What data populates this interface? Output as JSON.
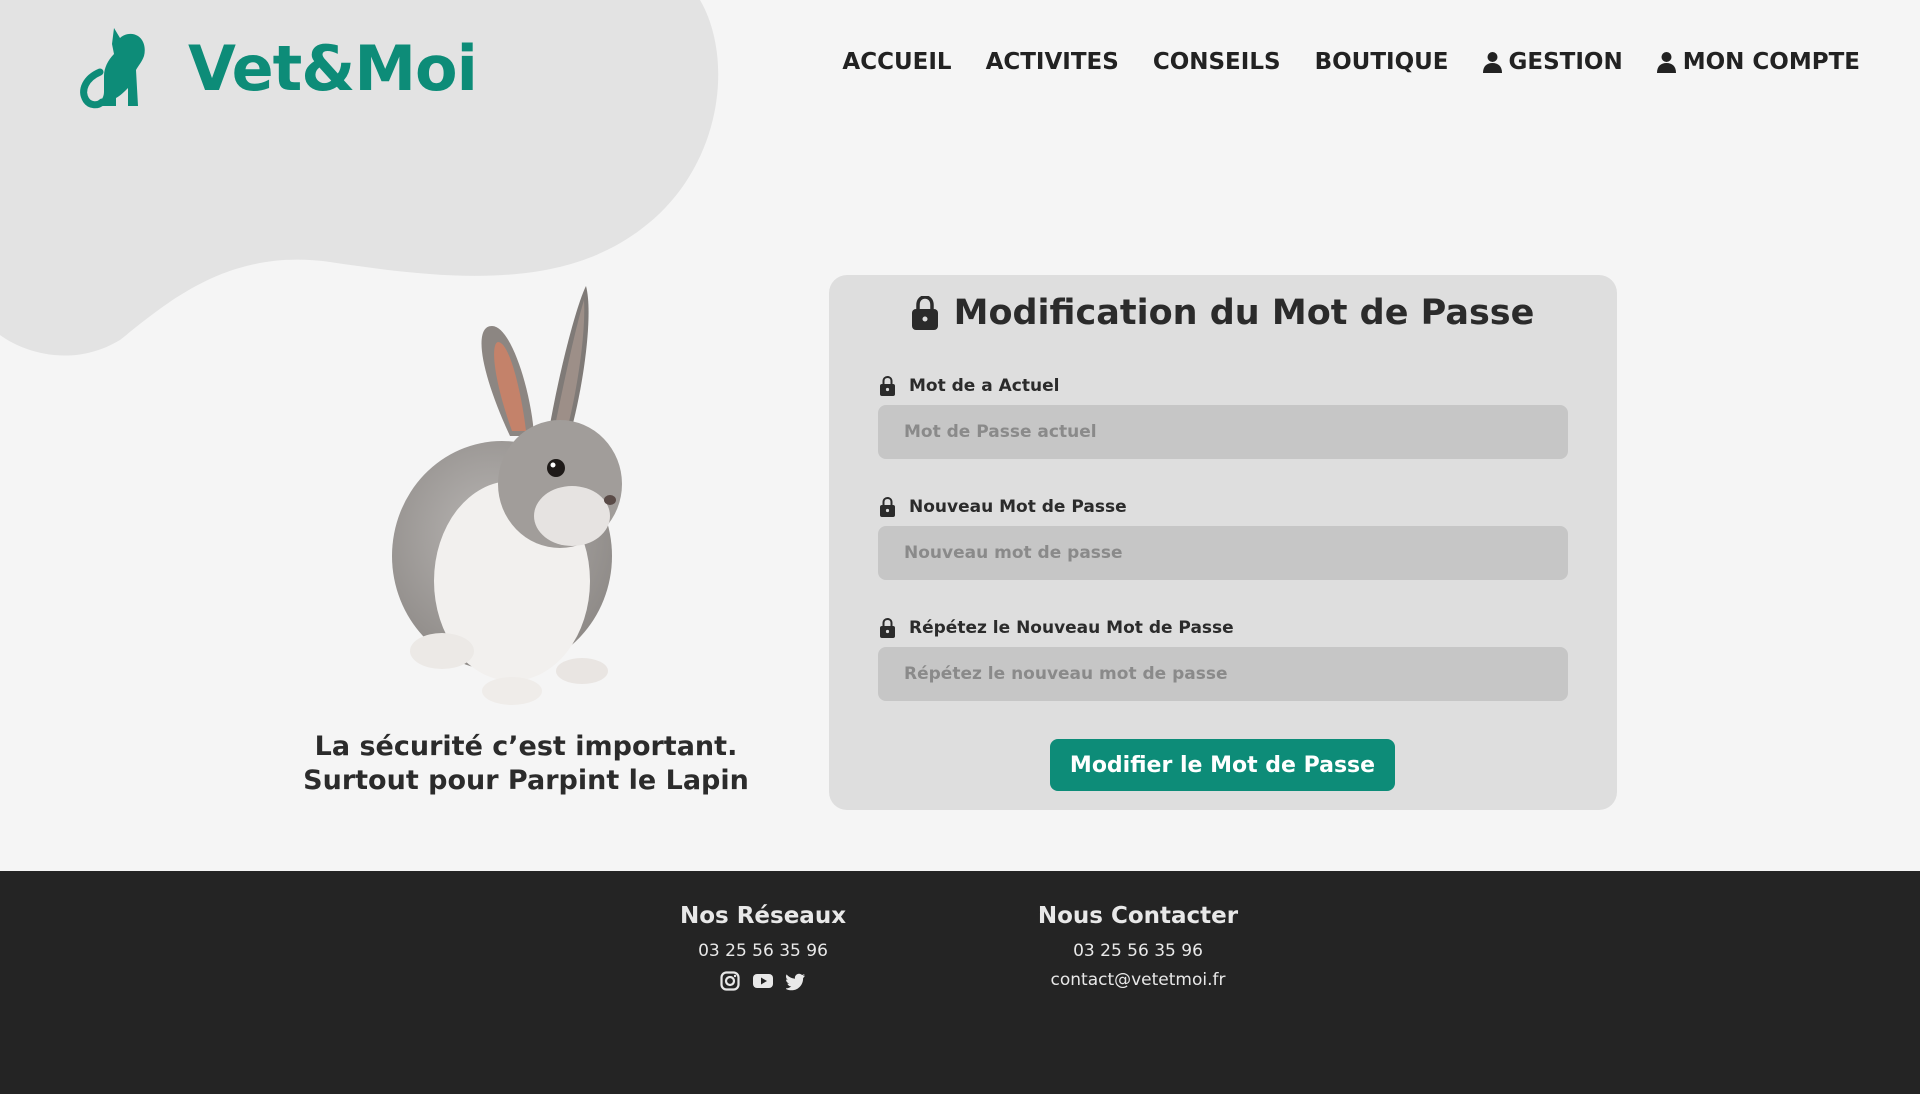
{
  "brand": {
    "name": "Vet&Moi",
    "color": "#0d8c78"
  },
  "nav": {
    "items": [
      "ACCUEIL",
      "ACTIVITES",
      "CONSEILS",
      "BOUTIQUE"
    ],
    "gestion": "GESTION",
    "account": "MON COMPTE"
  },
  "hero": {
    "caption_line1": "La sécurité c’est important.",
    "caption_line2": "Surtout pour Parpint le Lapin"
  },
  "form": {
    "title": "Modification du Mot de Passe",
    "fields": [
      {
        "label": "Mot de a Actuel",
        "placeholder": "Mot de Passe actuel",
        "value": ""
      },
      {
        "label": "Nouveau Mot de Passe",
        "placeholder": "Nouveau mot de passe",
        "value": ""
      },
      {
        "label": "Répétez le Nouveau Mot de Passe",
        "placeholder": "Répétez le nouveau mot de passe",
        "value": ""
      }
    ],
    "submit_label": "Modifier le Mot de Passe"
  },
  "footer": {
    "networks": {
      "title": "Nos Réseaux",
      "phone": "03 25 56 35 96",
      "icons": [
        "instagram-icon",
        "youtube-icon",
        "twitter-icon"
      ]
    },
    "contact": {
      "title": "Nous Contacter",
      "phone": "03 25 56 35 96",
      "email": "contact@vetetmoi.fr"
    }
  },
  "colors": {
    "background": "#f5f5f5",
    "card": "#dedede",
    "input": "#c6c6c6",
    "footer": "#242424",
    "accent": "#0d8c78"
  }
}
